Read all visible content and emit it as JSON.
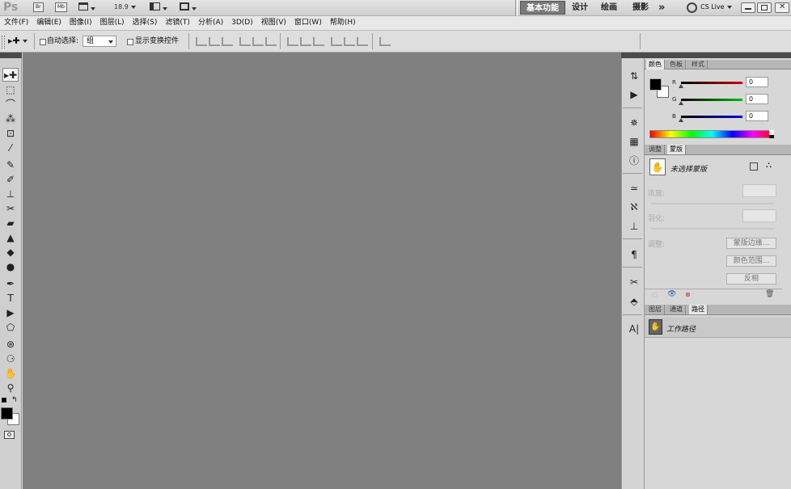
{
  "app": {
    "logo": "Ps",
    "bridge_btn": "Br",
    "minibridge_btn": "Mb",
    "zoom": "18.9",
    "cslive": "CS Live"
  },
  "workspaces": [
    "基本功能",
    "设计",
    "绘画",
    "摄影"
  ],
  "workspace_more": "»",
  "menu": [
    "文件(F)",
    "编辑(E)",
    "图像(I)",
    "图层(L)",
    "选择(S)",
    "滤镜(T)",
    "分析(A)",
    "3D(D)",
    "视图(V)",
    "窗口(W)",
    "帮助(H)"
  ],
  "options": {
    "auto_select_label": "自动选择:",
    "auto_select_value": "组",
    "show_transform_label": "显示变换控件"
  },
  "tools": [
    "▸✚",
    "⬚",
    "⌒",
    "⁂",
    "⊡",
    "⁄",
    "✎",
    "✐",
    "⊥",
    "✂",
    "▰",
    "▲",
    "◆",
    "●",
    "✒",
    "T",
    "▶",
    "⬠",
    "⊛",
    "⚆",
    "✋",
    "⚲"
  ],
  "panels": {
    "color": {
      "tabs": [
        "颜色",
        "色板",
        "样式"
      ],
      "channels": [
        {
          "label": "R",
          "value": "0",
          "color": "#cc0000"
        },
        {
          "label": "G",
          "value": "0",
          "color": "#00aa00"
        },
        {
          "label": "B",
          "value": "0",
          "color": "#0000cc"
        }
      ]
    },
    "masks": {
      "tabs": [
        "调整",
        "蒙版"
      ],
      "status": "未选择蒙版",
      "density_label": "浓度:",
      "feather_label": "羽化:",
      "refine_label": "调整:",
      "btn_edge": "蒙版边缘...",
      "btn_color_range": "颜色范围...",
      "btn_invert": "反相"
    },
    "paths": {
      "tabs": [
        "图层",
        "通道",
        "路径"
      ],
      "item": "工作路径"
    }
  }
}
